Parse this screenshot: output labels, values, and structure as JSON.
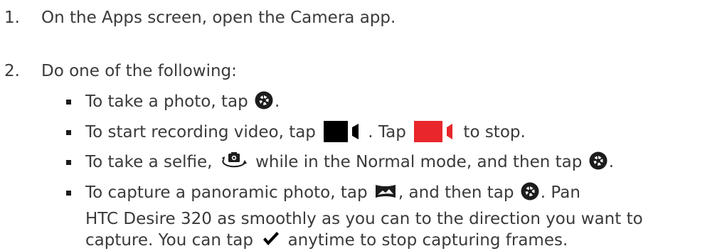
{
  "steps": [
    {
      "number": "1.",
      "text": "On the Apps screen, open the Camera app."
    },
    {
      "number": "2.",
      "text": "Do one of the following:"
    }
  ],
  "bullets": {
    "photo": {
      "before": "To take a photo, tap ",
      "after": "."
    },
    "video": {
      "before": "To start recording video, tap ",
      "middle": ". Tap ",
      "after": " to stop."
    },
    "selfie": {
      "before": "To take a selfie, ",
      "middle": " while in the Normal mode, and then tap ",
      "after": "."
    },
    "pano": {
      "line1_before": "To capture a panoramic photo, tap ",
      "line1_middle": ", and then tap ",
      "line1_after": ". Pan",
      "line2": "HTC Desire 320 as smoothly as you can to the direction you want to",
      "line3_before": "capture. You can tap ",
      "line3_after": " anytime to stop capturing frames."
    }
  },
  "icons": {
    "shutter": "shutter-icon",
    "video_record": "video-record-icon",
    "video_stop": "video-stop-icon",
    "switch_camera": "switch-camera-icon",
    "panorama": "panorama-icon",
    "check": "checkmark-icon"
  },
  "colors": {
    "text": "#3a3a3a",
    "icon": "#1c1c1c",
    "record_red": "#e8262b"
  }
}
